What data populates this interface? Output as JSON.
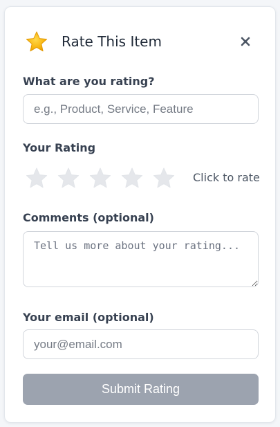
{
  "header": {
    "icon": "star-icon",
    "title": "Rate This Item",
    "close_icon": "close-icon",
    "close_symbol": "×"
  },
  "subject": {
    "label": "What are you rating?",
    "placeholder": "e.g., Product, Service, Feature",
    "value": ""
  },
  "rating": {
    "label": "Your Rating",
    "max": 5,
    "selected": 0,
    "hint": "Click to rate",
    "empty_star_color": "#e5e7eb",
    "title_star_color": "#f5b50a"
  },
  "comments": {
    "label": "Comments (optional)",
    "placeholder": "Tell us more about your rating...",
    "value": ""
  },
  "email": {
    "label": "Your email (optional)",
    "placeholder": "your@email.com",
    "value": ""
  },
  "submit": {
    "label": "Submit Rating",
    "disabled_color": "#9ca3af"
  }
}
